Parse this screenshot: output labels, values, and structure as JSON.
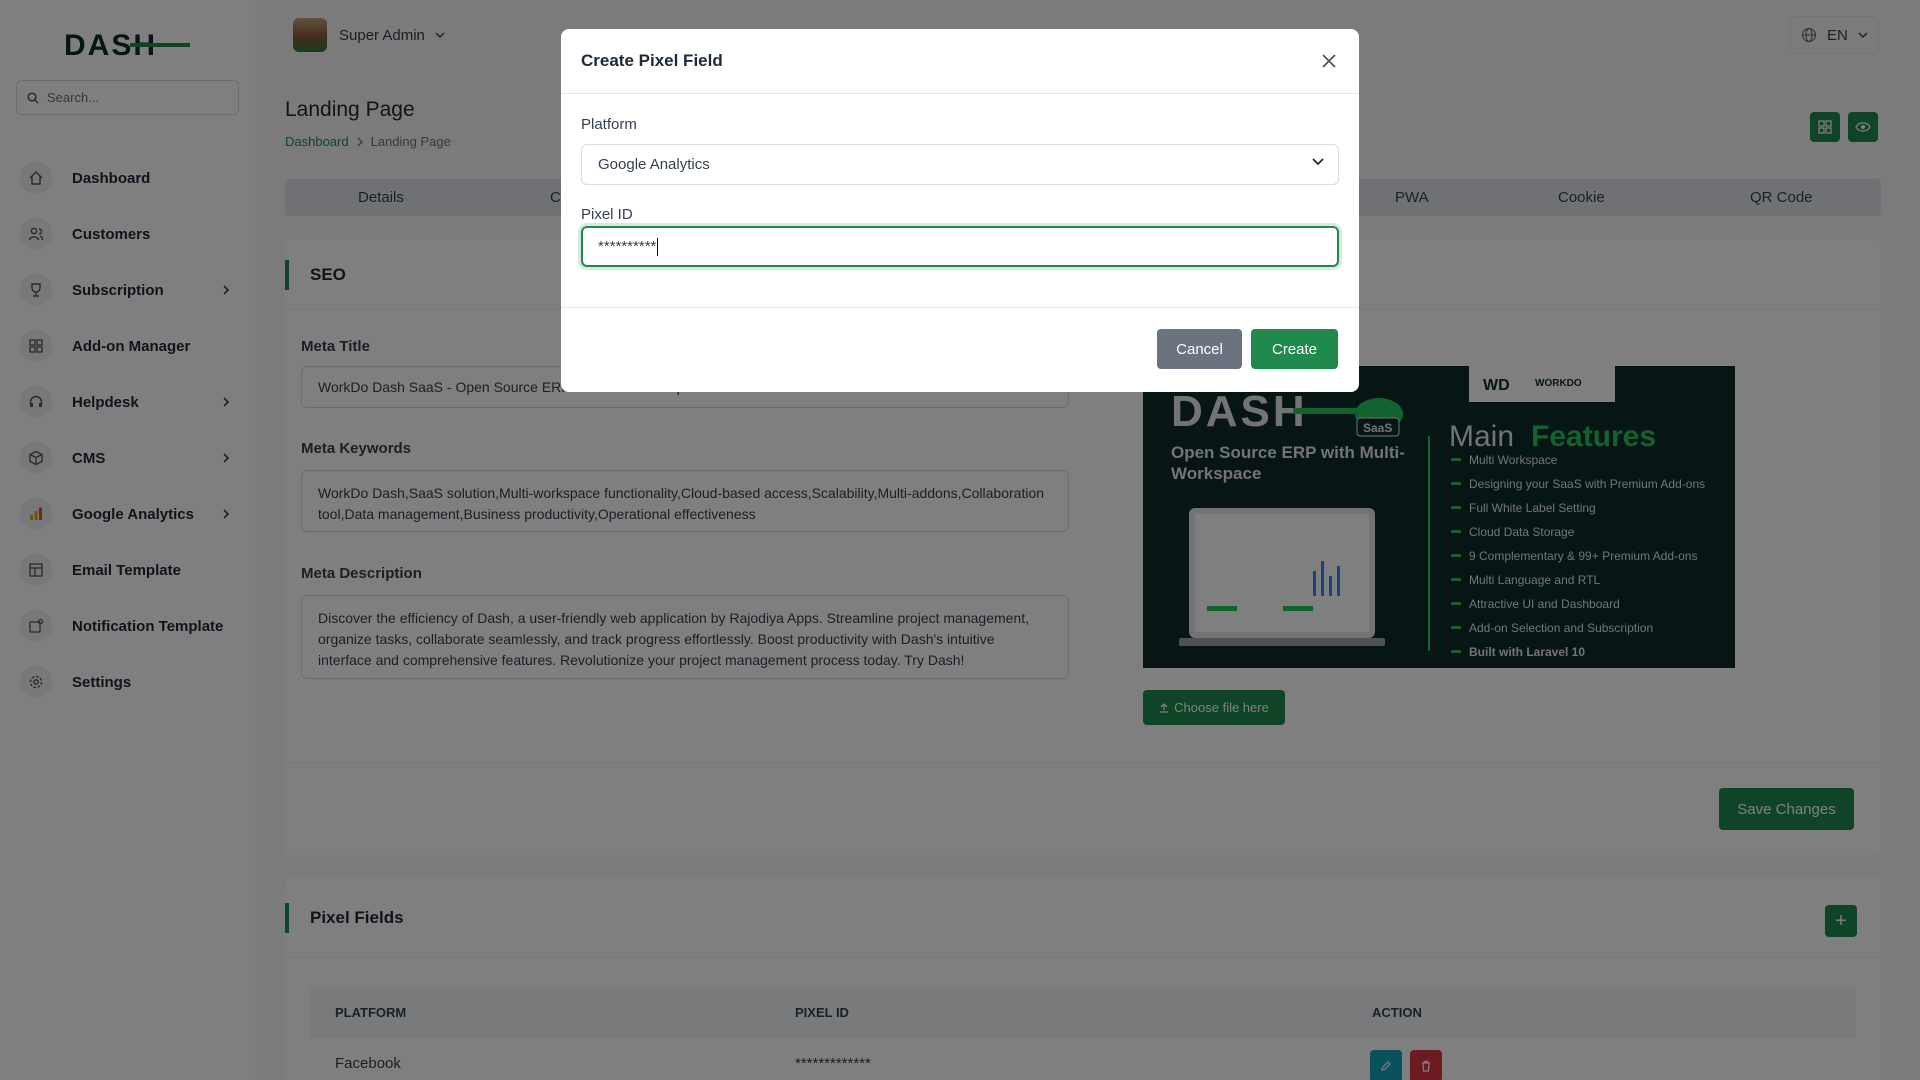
{
  "sidebar": {
    "search_placeholder": "Search...",
    "items": [
      {
        "label": "Dashboard",
        "icon": "home-icon",
        "has_children": false
      },
      {
        "label": "Customers",
        "icon": "users-icon",
        "has_children": false
      },
      {
        "label": "Subscription",
        "icon": "trophy-icon",
        "has_children": true
      },
      {
        "label": "Add-on Manager",
        "icon": "grid-icon",
        "has_children": false
      },
      {
        "label": "Helpdesk",
        "icon": "headphones-icon",
        "has_children": true
      },
      {
        "label": "CMS",
        "icon": "package-icon",
        "has_children": true
      },
      {
        "label": "Google Analytics",
        "icon": "bar-chart-icon",
        "has_children": true
      },
      {
        "label": "Email Template",
        "icon": "template-icon",
        "has_children": false
      },
      {
        "label": "Notification Template",
        "icon": "notification-icon",
        "has_children": false
      },
      {
        "label": "Settings",
        "icon": "gear-icon",
        "has_children": false
      }
    ]
  },
  "header": {
    "user_name": "Super Admin",
    "language": "EN"
  },
  "page": {
    "title": "Landing Page",
    "breadcrumb": [
      "Dashboard",
      "Landing Page"
    ]
  },
  "tabs": [
    "Details",
    "C",
    "PWA",
    "Cookie",
    "QR Code"
  ],
  "seo": {
    "title": "SEO",
    "meta_title_label": "Meta Title",
    "meta_title_value": "WorkDo Dash SaaS - Open Source ERP with Multi-Workspace",
    "meta_keywords_label": "Meta Keywords",
    "meta_keywords_value": "WorkDo Dash,SaaS solution,Multi-workspace functionality,Cloud-based access,Scalability,Multi-addons,Collaboration tool,Data management,Business productivity,Operational effectiveness",
    "meta_description_label": "Meta Description",
    "meta_description_value": "Discover the efficiency of Dash, a user-friendly web application by Rajodiya Apps. Streamline project management, organize tasks, collaborate seamlessly, and track progress effortlessly. Boost productivity with Dash's intuitive interface and comprehensive features. Revolutionize your project management process today. Try Dash!",
    "choose_file_label": "Choose file here",
    "save_label": "Save Changes",
    "preview": {
      "brand": "WORKDO",
      "saas_badge": "SaaS",
      "tagline": "Open Source ERP with Multi-Workspace",
      "heading_plain": "Main",
      "heading_accent": "Features",
      "features": [
        "Multi Workspace",
        "Designing your SaaS with Premium Add-ons",
        "Full White Label Setting",
        "Cloud Data Storage",
        "9 Complementary & 99+ Premium Add-ons",
        "Multi Language and RTL",
        "Attractive UI and Dashboard",
        "Add-on Selection and Subscription",
        "Built with Laravel 10"
      ]
    }
  },
  "pixel_fields": {
    "title": "Pixel Fields",
    "columns": [
      "PLATFORM",
      "PIXEL ID",
      "ACTION"
    ],
    "rows": [
      {
        "platform": "Facebook",
        "pixel_id": "*************"
      }
    ]
  },
  "modal": {
    "title": "Create Pixel Field",
    "platform_label": "Platform",
    "platform_value": "Google Analytics",
    "pixel_id_label": "Pixel ID",
    "pixel_id_value": "**********",
    "cancel_label": "Cancel",
    "create_label": "Create"
  },
  "colors": {
    "accent": "#1f8a4c",
    "cancel": "#6b7280",
    "overlay": "rgba(0,0,0,0.5)"
  }
}
